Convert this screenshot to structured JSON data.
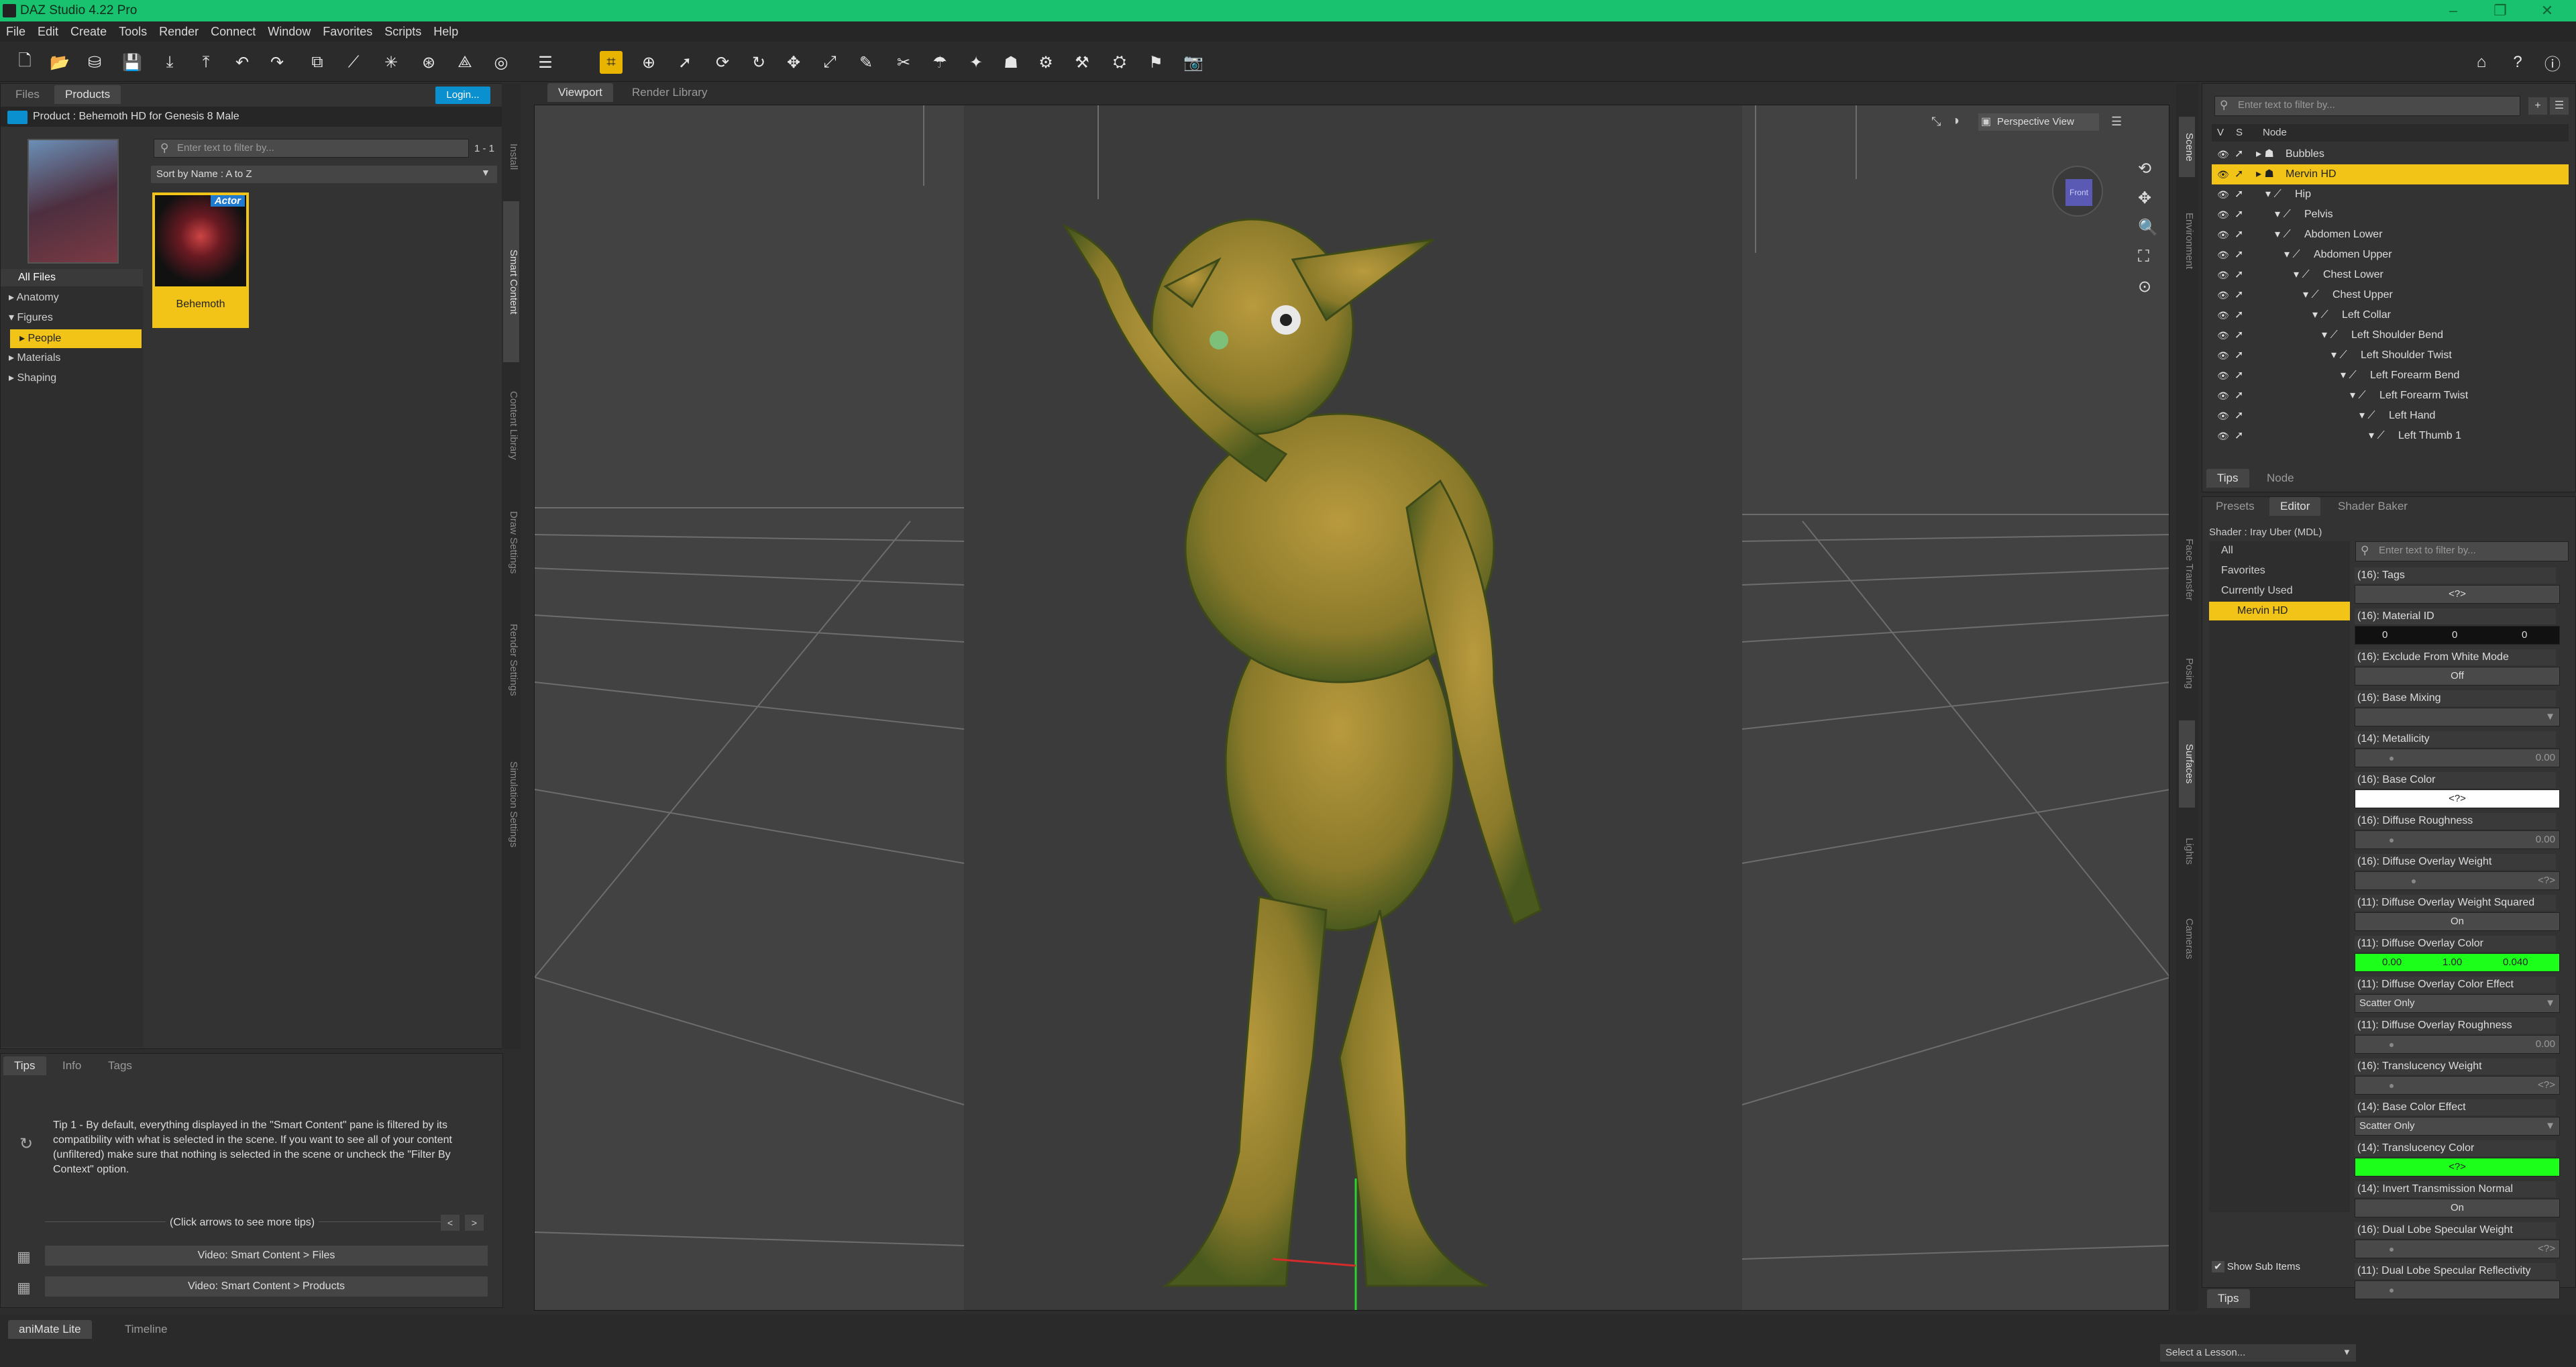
{
  "app": {
    "title": "DAZ Studio 4.22 Pro"
  },
  "menu": [
    "File",
    "Edit",
    "Create",
    "Tools",
    "Render",
    "Connect",
    "Window",
    "Favorites",
    "Scripts",
    "Help"
  ],
  "window_controls": [
    "–",
    "❐",
    "✕"
  ],
  "left": {
    "tabs": [
      "Files",
      "Products"
    ],
    "login_label": "Login...",
    "product_title": "Product : Behemoth HD for Genesis 8 Male",
    "filter_placeholder": "Enter text to filter by...",
    "count": "1 - 1",
    "sort": "Sort by Name : A to Z",
    "categories": [
      {
        "label": "All Files",
        "indent": 0
      },
      {
        "label": "▸ Anatomy",
        "indent": 0
      },
      {
        "label": "▾ Figures",
        "indent": 0
      },
      {
        "label": "▸ People",
        "indent": 1,
        "selected": true
      },
      {
        "label": "▸ Materials",
        "indent": 0
      },
      {
        "label": "▸ Shaping",
        "indent": 0
      }
    ],
    "item": {
      "badge": "Actor",
      "label": "Behemoth"
    },
    "vertical_tabs": [
      "Install",
      "Smart Content",
      "Content Library",
      "Draw Settings",
      "Render Settings",
      "Simulation Settings"
    ],
    "bottom_tabs": [
      "Tips",
      "Info",
      "Tags"
    ],
    "tip_text": "Tip 1 - By default, everything displayed in the \"Smart Content\" pane is filtered by its compatibility with what is selected in the scene. If you want to see all of your content (unfiltered) make sure that nothing is selected in the scene or uncheck the \"Filter By Context\" option.",
    "tip_nav": "(Click arrows to see more tips)",
    "video1": "Video: Smart Content > Files",
    "video2": "Video: Smart Content > Products"
  },
  "viewport": {
    "tabs": [
      "Viewport",
      "Render Library"
    ],
    "view": "Perspective View",
    "cube": "Front"
  },
  "scene": {
    "vertical_tabs": [
      "Scene",
      "Environment"
    ],
    "filter_placeholder": "Enter text to filter by...",
    "headers": [
      "V",
      "S",
      "Node"
    ],
    "nodes": [
      {
        "label": "Bubbles",
        "depth": 0,
        "type": "figure"
      },
      {
        "label": "Mervin HD",
        "depth": 0,
        "type": "figure",
        "selected": true
      },
      {
        "label": "Hip",
        "depth": 1,
        "type": "bone"
      },
      {
        "label": "Pelvis",
        "depth": 2,
        "type": "bone"
      },
      {
        "label": "Abdomen Lower",
        "depth": 2,
        "type": "bone"
      },
      {
        "label": "Abdomen Upper",
        "depth": 3,
        "type": "bone"
      },
      {
        "label": "Chest Lower",
        "depth": 4,
        "type": "bone"
      },
      {
        "label": "Chest Upper",
        "depth": 5,
        "type": "bone"
      },
      {
        "label": "Left Collar",
        "depth": 6,
        "type": "bone"
      },
      {
        "label": "Left Shoulder Bend",
        "depth": 7,
        "type": "bone"
      },
      {
        "label": "Left Shoulder Twist",
        "depth": 8,
        "type": "bone"
      },
      {
        "label": "Left Forearm Bend",
        "depth": 9,
        "type": "bone"
      },
      {
        "label": "Left Forearm Twist",
        "depth": 10,
        "type": "bone"
      },
      {
        "label": "Left Hand",
        "depth": 11,
        "type": "bone"
      },
      {
        "label": "Left Thumb 1",
        "depth": 12,
        "type": "bone"
      }
    ],
    "bottom_tabs": [
      "Tips",
      "Node"
    ]
  },
  "surfaces": {
    "side_tabs": [
      "Face Transfer",
      "Posing",
      "Surfaces",
      "Lights",
      "Cameras"
    ],
    "tabs": [
      "Presets",
      "Editor",
      "Shader Baker"
    ],
    "shader": "Shader : Iray Uber (MDL)",
    "filter_placeholder": "Enter text to filter by...",
    "groups": [
      "All",
      "Favorites",
      "Currently Used"
    ],
    "selected": "Mervin HD",
    "show_sub": "Show Sub Items",
    "bottom_tab": "Tips",
    "props": [
      {
        "label": "(16): Tags",
        "kind": "text",
        "value": "<?>"
      },
      {
        "label": "(16): Material ID",
        "kind": "triple",
        "value": [
          "0",
          "0",
          "0"
        ]
      },
      {
        "label": "(16): Exclude From White Mode",
        "kind": "toggle",
        "value": "Off"
      },
      {
        "label": "(16): Base Mixing",
        "kind": "dropdown",
        "value": ""
      },
      {
        "label": "(14): Metallicity",
        "kind": "slider",
        "value": "0.00",
        "level": 0.05
      },
      {
        "label": "(16): Base Color",
        "kind": "color",
        "value": "<?>",
        "color": "#ffffff"
      },
      {
        "label": "(16): Diffuse Roughness",
        "kind": "slider",
        "value": "0.00",
        "level": 0.05
      },
      {
        "label": "(16): Diffuse Overlay Weight",
        "kind": "slider",
        "value": "<?>",
        "level": 0.2
      },
      {
        "label": "(11): Diffuse Overlay Weight Squared",
        "kind": "toggle",
        "value": "On"
      },
      {
        "label": "(11): Diffuse Overlay Color",
        "kind": "rgb",
        "value": [
          "0.00",
          "1.00",
          "0.040"
        ],
        "color": "#1bff1b"
      },
      {
        "label": "(11): Diffuse Overlay Color Effect",
        "kind": "dropdown",
        "value": "Scatter Only"
      },
      {
        "label": "(11): Diffuse Overlay Roughness",
        "kind": "slider",
        "value": "0.00",
        "level": 0.05
      },
      {
        "label": "(16): Translucency Weight",
        "kind": "slider",
        "value": "<?>",
        "level": 0.05
      },
      {
        "label": "(14): Base Color Effect",
        "kind": "dropdown",
        "value": "Scatter Only"
      },
      {
        "label": "(14): Translucency Color",
        "kind": "color",
        "value": "<?>",
        "color": "#1bff1b"
      },
      {
        "label": "(14): Invert Transmission Normal",
        "kind": "toggle",
        "value": "On"
      },
      {
        "label": "(16): Dual Lobe Specular Weight",
        "kind": "slider",
        "value": "<?>",
        "level": 0.05
      },
      {
        "label": "(11): Dual Lobe Specular Reflectivity",
        "kind": "slider",
        "value": "",
        "level": 0.05
      }
    ]
  },
  "bottom": {
    "tabs": [
      "aniMate Lite",
      "Timeline"
    ],
    "lesson": "Select a Lesson..."
  }
}
